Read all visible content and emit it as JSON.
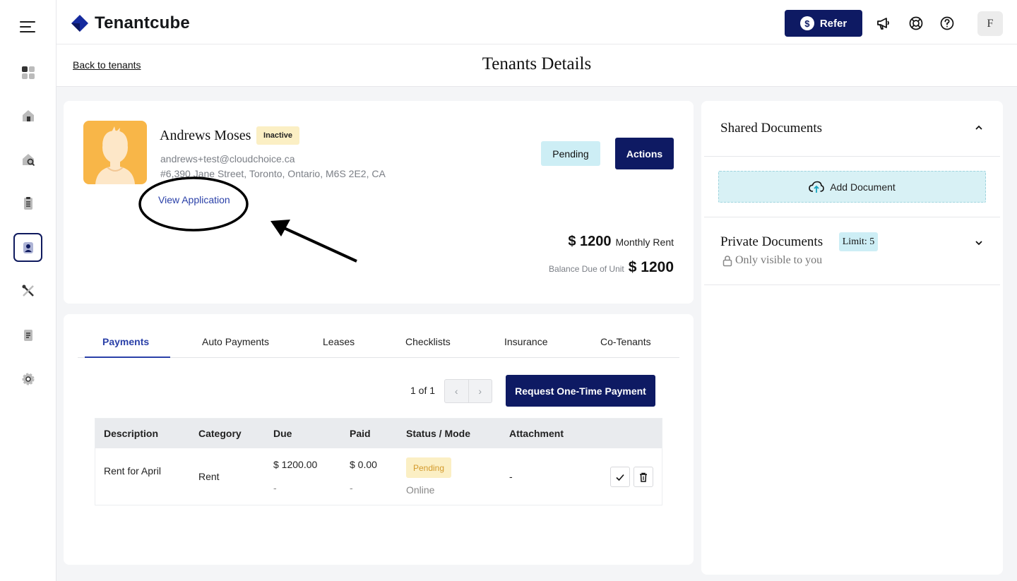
{
  "app": {
    "name": "Tenantcube"
  },
  "topbar": {
    "refer_label": "Refer",
    "refer_symbol": "$",
    "user_initial": "F"
  },
  "header": {
    "back_link": "Back to tenants",
    "title": "Tenants Details"
  },
  "tenant": {
    "name": "Andrews Moses",
    "status_badge": "Inactive",
    "email": "andrews+test@cloudchoice.ca",
    "address": "#6,390 Jane Street, Toronto, Ontario, M6S 2E2, CA",
    "view_application": "View Application",
    "pending_label": "Pending",
    "actions_label": "Actions",
    "monthly_rent_amount": "$ 1200",
    "monthly_rent_label": "Monthly Rent",
    "balance_label": "Balance Due of Unit",
    "balance_amount": "$ 1200"
  },
  "tabs": [
    {
      "label": "Payments",
      "active": true
    },
    {
      "label": "Auto Payments"
    },
    {
      "label": "Leases"
    },
    {
      "label": "Checklists"
    },
    {
      "label": "Insurance"
    },
    {
      "label": "Co-Tenants"
    }
  ],
  "payments": {
    "pager_text": "1 of 1",
    "pager_prev": "‹",
    "pager_next": "›",
    "request_button": "Request One-Time Payment",
    "columns": [
      "Description",
      "Category",
      "Due",
      "Paid",
      "Status / Mode",
      "Attachment"
    ],
    "rows": [
      {
        "description": "Rent for April",
        "category": "Rent",
        "due": "$ 1200.00",
        "due_sub": "-",
        "paid": "$ 0.00",
        "paid_sub": "-",
        "status": "Pending",
        "mode": "Online",
        "attachment": "-"
      }
    ]
  },
  "documents": {
    "shared_title": "Shared Documents",
    "add_document": "Add Document",
    "private_title": "Private Documents",
    "limit_badge": "Limit: 5",
    "visibility_note": "Only visible to you"
  },
  "colors": {
    "brand_navy": "#0e1a63",
    "link_blue": "#2a40a8",
    "pending_bg": "#cdeef5",
    "inactive_bg": "#fbefc4",
    "avatar_orange": "#f8b648"
  }
}
